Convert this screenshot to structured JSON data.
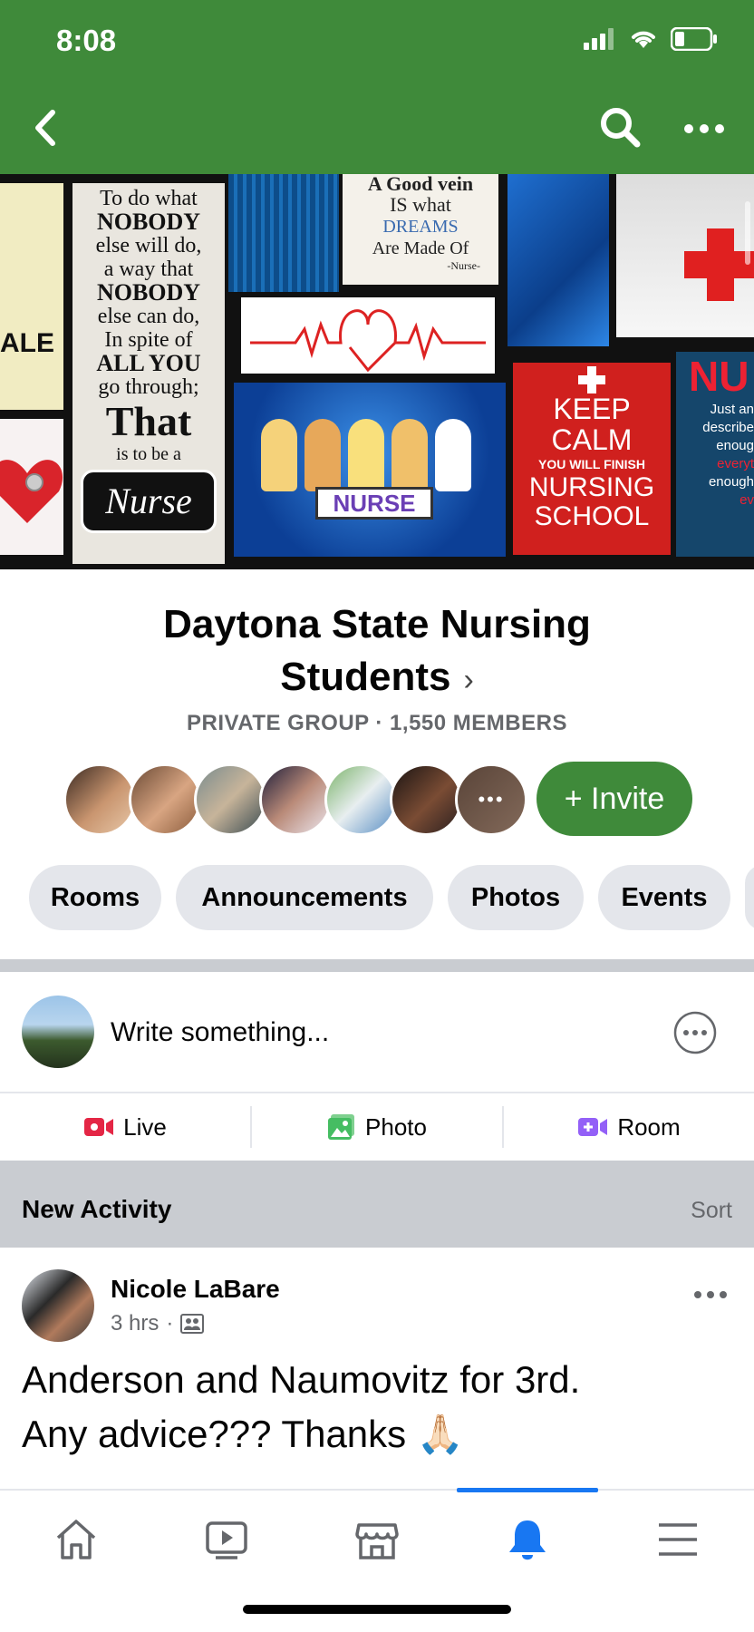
{
  "status_bar": {
    "time": "8:08"
  },
  "header": {
    "back_icon": "chevron-left-icon",
    "search_icon": "search-icon",
    "more_icon": "more-horizontal-icon",
    "bg_color": "#3f8a3a"
  },
  "cover": {
    "texts": {
      "left_partial": "ALE",
      "quote": [
        "To do what",
        "NOBODY",
        "else will do,",
        "a way that",
        "NOBODY",
        "else can do,",
        "In spite of",
        "ALL YOU",
        "go through;",
        "That",
        "is to be a",
        "Nurse"
      ],
      "vein": [
        "A Good vein",
        "IS what",
        "DREAMS",
        "Are Made Of",
        "-Nurse-"
      ],
      "nurse_banner": "NURSE",
      "keep_calm": [
        "KEEP",
        "CALM",
        "YOU WILL FINISH",
        "NURSING",
        "SCHOOL"
      ],
      "right_partial": [
        "NU",
        "Just an",
        "describe",
        "enoug",
        "everyt",
        "enough",
        "ev"
      ]
    }
  },
  "group": {
    "name_line1": "Daytona State Nursing",
    "name_line2": "Students",
    "meta": "PRIVATE GROUP · 1,550 MEMBERS",
    "invite_label": "+ Invite",
    "more_members_glyph": "•••"
  },
  "chips": [
    "Rooms",
    "Announcements",
    "Photos",
    "Events"
  ],
  "composer": {
    "placeholder": "Write something...",
    "actions": [
      {
        "label": "Live",
        "icon": "live-video-icon",
        "color": "#e42645"
      },
      {
        "label": "Photo",
        "icon": "photo-icon",
        "color": "#45bd62"
      },
      {
        "label": "Room",
        "icon": "room-video-icon",
        "color": "#9360f7"
      }
    ]
  },
  "activity": {
    "title": "New Activity",
    "sort_label": "Sort"
  },
  "post": {
    "author": "Nicole LaBare",
    "time": "3 hrs",
    "audience_icon": "group-audience-icon",
    "text_line1": "Anderson and Naumovitz for 3rd.",
    "text_line2": "Any advice??? Thanks 🙏🏻"
  },
  "bottom_nav": {
    "items": [
      "home-icon",
      "watch-icon",
      "marketplace-icon",
      "notifications-icon",
      "menu-icon"
    ],
    "active": "notifications-icon",
    "active_color": "#1877f2"
  }
}
